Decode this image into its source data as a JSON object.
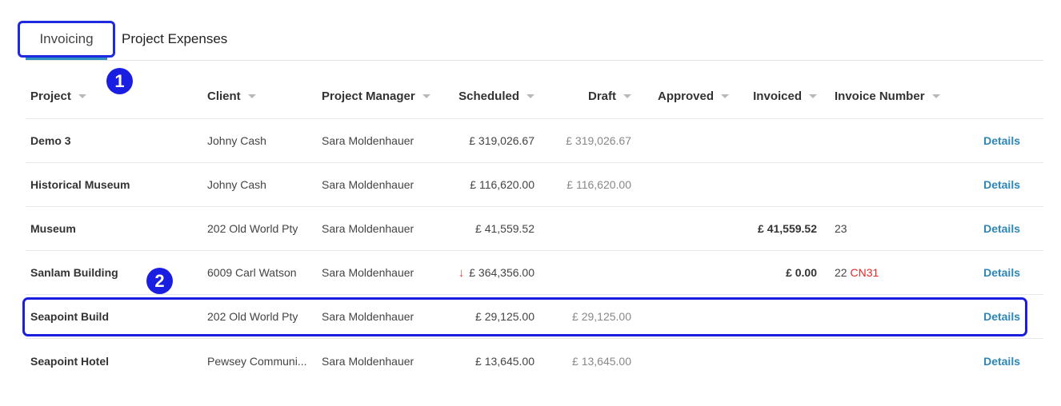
{
  "tabs": [
    {
      "label": "Invoicing",
      "active": true
    },
    {
      "label": "Project Expenses",
      "active": false
    }
  ],
  "callouts": [
    "1",
    "2"
  ],
  "columns": {
    "project": "Project",
    "client": "Client",
    "project_manager": "Project Manager",
    "scheduled": "Scheduled",
    "draft": "Draft",
    "approved": "Approved",
    "invoiced": "Invoiced",
    "invoice_number": "Invoice Number"
  },
  "rows": [
    {
      "project": "Demo 3",
      "client": "Johny Cash",
      "project_manager": "Sara Moldenhauer",
      "scheduled": "£ 319,026.67",
      "draft": "£ 319,026.67",
      "approved": "",
      "invoiced": "",
      "invoice_number": "",
      "credit_note": "",
      "details": "Details"
    },
    {
      "project": "Historical Museum",
      "client": "Johny Cash",
      "project_manager": "Sara Moldenhauer",
      "scheduled": "£ 116,620.00",
      "draft": "£ 116,620.00",
      "approved": "",
      "invoiced": "",
      "invoice_number": "",
      "credit_note": "",
      "details": "Details"
    },
    {
      "project": "Museum",
      "client": "202 Old World Pty",
      "project_manager": "Sara Moldenhauer",
      "scheduled": "£ 41,559.52",
      "draft": "",
      "approved": "",
      "invoiced": "£ 41,559.52",
      "invoice_number": "23",
      "credit_note": "",
      "details": "Details"
    },
    {
      "project": "Sanlam Building",
      "client": "6009 Carl Watson",
      "project_manager": "Sara Moldenhauer",
      "scheduled": "£ 364,356.00",
      "scheduled_icon": "down-arrow-icon",
      "draft": "",
      "approved": "",
      "invoiced": "£ 0.00",
      "invoice_number": "22",
      "credit_note": "CN31",
      "details": "Details"
    },
    {
      "project": "Seapoint Build",
      "client": "202 Old World Pty",
      "project_manager": "Sara Moldenhauer",
      "scheduled": "£ 29,125.00",
      "draft": "£ 29,125.00",
      "approved": "",
      "invoiced": "",
      "invoice_number": "",
      "credit_note": "",
      "details": "Details"
    },
    {
      "project": "Seapoint Hotel",
      "client": "Pewsey Communi...",
      "project_manager": "Sara Moldenhauer",
      "scheduled": "£ 13,645.00",
      "draft": "£ 13,645.00",
      "approved": "",
      "invoiced": "",
      "invoice_number": "",
      "credit_note": "",
      "details": "Details"
    }
  ],
  "colors": {
    "accent": "#2e8fbf",
    "highlight": "#1a1ee0",
    "link": "#2e86b5",
    "negative": "#e02a2a"
  }
}
